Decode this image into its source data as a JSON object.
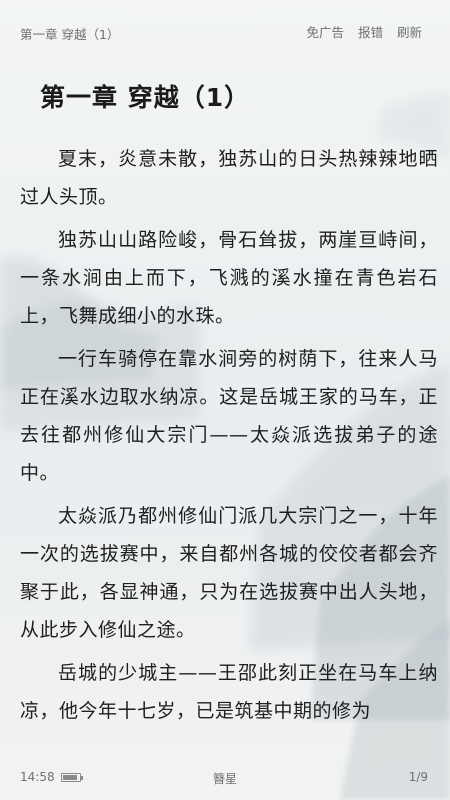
{
  "header": {
    "chapter_short": "第一章 穿越（1）",
    "actions": [
      {
        "label": "免广告"
      },
      {
        "label": "报错"
      },
      {
        "label": "刷新"
      }
    ]
  },
  "chapter": {
    "title": "第一章 穿越（1）",
    "paragraphs": [
      "夏末，炎意未散，独苏山的日头热辣辣地晒过人头顶。",
      "独苏山山路险峻，骨石耸拔，两崖亘峙间，一条水涧由上而下，飞溅的溪水撞在青色岩石上，飞舞成细小的水珠。",
      "一行车骑停在靠水涧旁的树荫下，往来人马正在溪水边取水纳凉。这是岳城王家的马车，正去往都州修仙大宗门——太焱派选拔弟子的途中。",
      "太焱派乃都州修仙门派几大宗门之一，十年一次的选拔赛中，来自都州各城的佼佼者都会齐聚于此，各显神通，只为在选拔赛中出人头地，从此步入修仙之途。",
      "岳城的少城主——王邵此刻正坐在马车上纳凉，他今年十七岁，已是筑基中期的修为"
    ]
  },
  "footer": {
    "time": "14:58",
    "battery_level": 0.85,
    "book_name": "簪星",
    "page": "1/9"
  },
  "colors": {
    "background": "#eef1f2",
    "text": "#1f1f1f",
    "muted": "#6f6f6f"
  }
}
